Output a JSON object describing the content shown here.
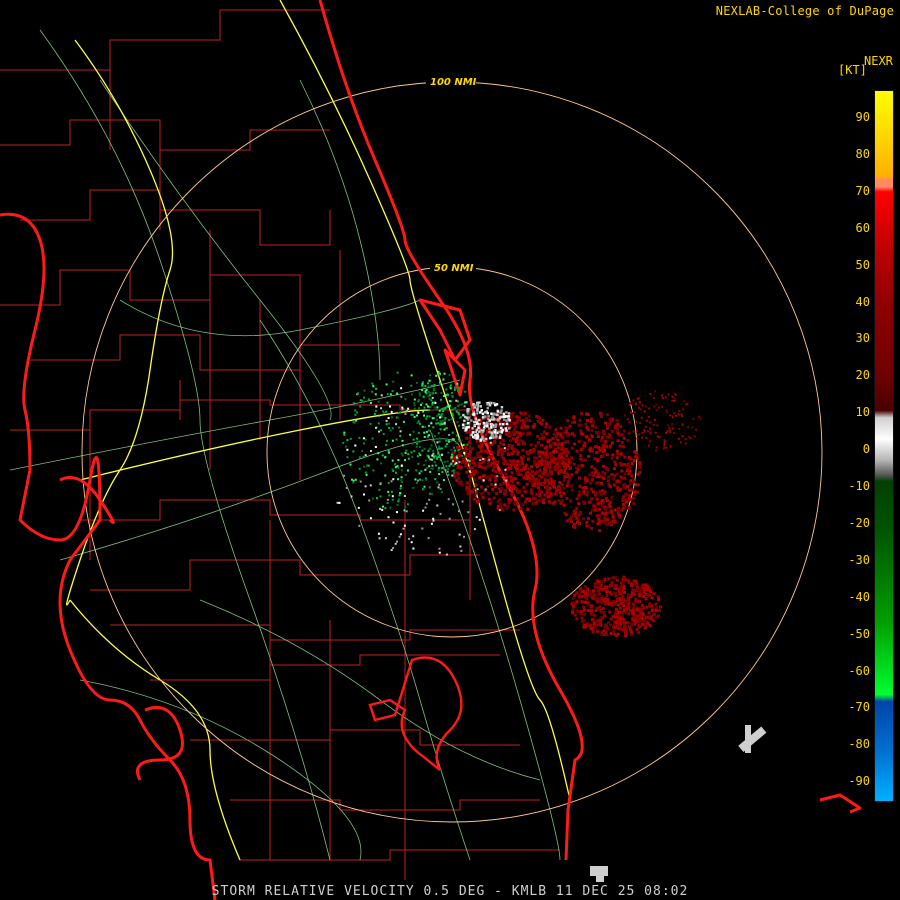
{
  "credit": "NEXLAB-College of DuPage",
  "scale": {
    "title": "NEXR",
    "unit": "[KT]",
    "ticks": [
      "90",
      "80",
      "70",
      "60",
      "50",
      "40",
      "30",
      "20",
      "10",
      "0",
      "-10",
      "-20",
      "-30",
      "-40",
      "-50",
      "-60",
      "-70",
      "-80",
      "-90"
    ]
  },
  "range_rings": [
    "100 NMI",
    "50 NMI"
  ],
  "caption": "STORM RELATIVE VELOCITY 0.5 DEG - KMLB 11 DEC 25 08:02",
  "colors": {
    "coast": "#ff1a1a",
    "county": "#cc2222",
    "highway": "#ffff55",
    "road": "#88cc88",
    "ring": "#ffcc99",
    "inbound": "#00c030",
    "outbound": "#8b0000"
  }
}
